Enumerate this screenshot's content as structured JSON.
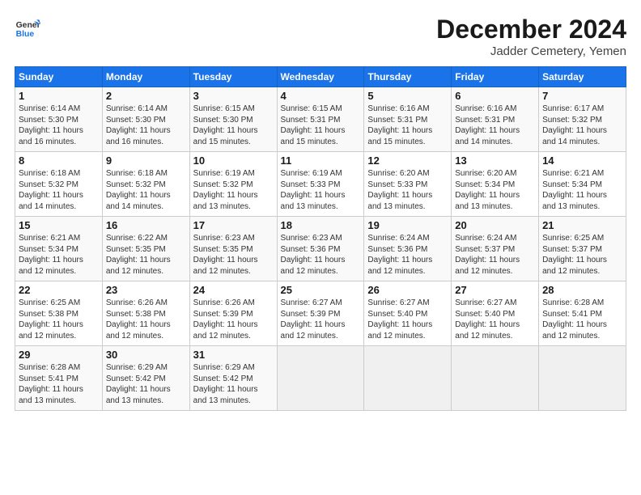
{
  "logo": {
    "text_general": "General",
    "text_blue": "Blue"
  },
  "header": {
    "month": "December 2024",
    "location": "Jadder Cemetery, Yemen"
  },
  "weekdays": [
    "Sunday",
    "Monday",
    "Tuesday",
    "Wednesday",
    "Thursday",
    "Friday",
    "Saturday"
  ],
  "weeks": [
    [
      {
        "day": "1",
        "sunrise": "6:14 AM",
        "sunset": "5:30 PM",
        "daylight": "11 hours and 16 minutes."
      },
      {
        "day": "2",
        "sunrise": "6:14 AM",
        "sunset": "5:30 PM",
        "daylight": "11 hours and 16 minutes."
      },
      {
        "day": "3",
        "sunrise": "6:15 AM",
        "sunset": "5:30 PM",
        "daylight": "11 hours and 15 minutes."
      },
      {
        "day": "4",
        "sunrise": "6:15 AM",
        "sunset": "5:31 PM",
        "daylight": "11 hours and 15 minutes."
      },
      {
        "day": "5",
        "sunrise": "6:16 AM",
        "sunset": "5:31 PM",
        "daylight": "11 hours and 15 minutes."
      },
      {
        "day": "6",
        "sunrise": "6:16 AM",
        "sunset": "5:31 PM",
        "daylight": "11 hours and 14 minutes."
      },
      {
        "day": "7",
        "sunrise": "6:17 AM",
        "sunset": "5:32 PM",
        "daylight": "11 hours and 14 minutes."
      }
    ],
    [
      {
        "day": "8",
        "sunrise": "6:18 AM",
        "sunset": "5:32 PM",
        "daylight": "11 hours and 14 minutes."
      },
      {
        "day": "9",
        "sunrise": "6:18 AM",
        "sunset": "5:32 PM",
        "daylight": "11 hours and 14 minutes."
      },
      {
        "day": "10",
        "sunrise": "6:19 AM",
        "sunset": "5:32 PM",
        "daylight": "11 hours and 13 minutes."
      },
      {
        "day": "11",
        "sunrise": "6:19 AM",
        "sunset": "5:33 PM",
        "daylight": "11 hours and 13 minutes."
      },
      {
        "day": "12",
        "sunrise": "6:20 AM",
        "sunset": "5:33 PM",
        "daylight": "11 hours and 13 minutes."
      },
      {
        "day": "13",
        "sunrise": "6:20 AM",
        "sunset": "5:34 PM",
        "daylight": "11 hours and 13 minutes."
      },
      {
        "day": "14",
        "sunrise": "6:21 AM",
        "sunset": "5:34 PM",
        "daylight": "11 hours and 13 minutes."
      }
    ],
    [
      {
        "day": "15",
        "sunrise": "6:21 AM",
        "sunset": "5:34 PM",
        "daylight": "11 hours and 12 minutes."
      },
      {
        "day": "16",
        "sunrise": "6:22 AM",
        "sunset": "5:35 PM",
        "daylight": "11 hours and 12 minutes."
      },
      {
        "day": "17",
        "sunrise": "6:23 AM",
        "sunset": "5:35 PM",
        "daylight": "11 hours and 12 minutes."
      },
      {
        "day": "18",
        "sunrise": "6:23 AM",
        "sunset": "5:36 PM",
        "daylight": "11 hours and 12 minutes."
      },
      {
        "day": "19",
        "sunrise": "6:24 AM",
        "sunset": "5:36 PM",
        "daylight": "11 hours and 12 minutes."
      },
      {
        "day": "20",
        "sunrise": "6:24 AM",
        "sunset": "5:37 PM",
        "daylight": "11 hours and 12 minutes."
      },
      {
        "day": "21",
        "sunrise": "6:25 AM",
        "sunset": "5:37 PM",
        "daylight": "11 hours and 12 minutes."
      }
    ],
    [
      {
        "day": "22",
        "sunrise": "6:25 AM",
        "sunset": "5:38 PM",
        "daylight": "11 hours and 12 minutes."
      },
      {
        "day": "23",
        "sunrise": "6:26 AM",
        "sunset": "5:38 PM",
        "daylight": "11 hours and 12 minutes."
      },
      {
        "day": "24",
        "sunrise": "6:26 AM",
        "sunset": "5:39 PM",
        "daylight": "11 hours and 12 minutes."
      },
      {
        "day": "25",
        "sunrise": "6:27 AM",
        "sunset": "5:39 PM",
        "daylight": "11 hours and 12 minutes."
      },
      {
        "day": "26",
        "sunrise": "6:27 AM",
        "sunset": "5:40 PM",
        "daylight": "11 hours and 12 minutes."
      },
      {
        "day": "27",
        "sunrise": "6:27 AM",
        "sunset": "5:40 PM",
        "daylight": "11 hours and 12 minutes."
      },
      {
        "day": "28",
        "sunrise": "6:28 AM",
        "sunset": "5:41 PM",
        "daylight": "11 hours and 12 minutes."
      }
    ],
    [
      {
        "day": "29",
        "sunrise": "6:28 AM",
        "sunset": "5:41 PM",
        "daylight": "11 hours and 13 minutes."
      },
      {
        "day": "30",
        "sunrise": "6:29 AM",
        "sunset": "5:42 PM",
        "daylight": "11 hours and 13 minutes."
      },
      {
        "day": "31",
        "sunrise": "6:29 AM",
        "sunset": "5:42 PM",
        "daylight": "11 hours and 13 minutes."
      },
      null,
      null,
      null,
      null
    ]
  ]
}
